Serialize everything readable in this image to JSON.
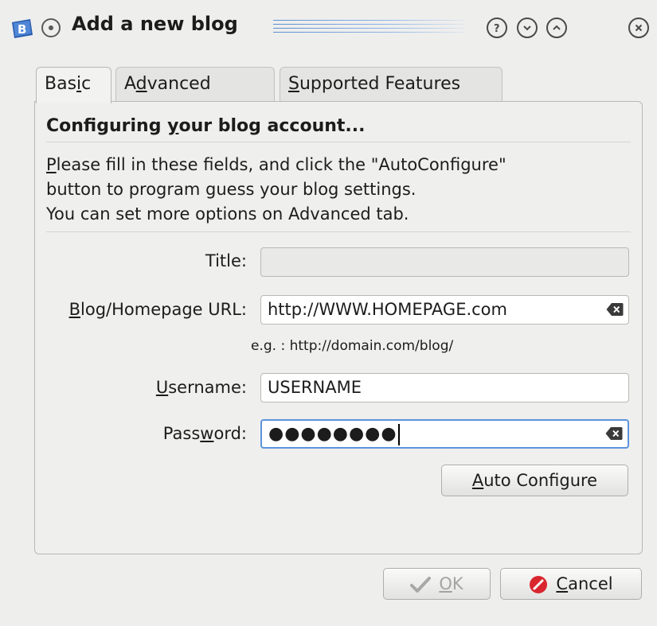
{
  "window": {
    "title": "Add a new blog",
    "app_icon": "blogilo-icon",
    "buttons": [
      "help-icon",
      "minimize-icon",
      "maximize-icon",
      "close-icon"
    ]
  },
  "tabs": [
    {
      "pre": "Bas",
      "accel": "i",
      "post": "c",
      "active": true
    },
    {
      "pre": "A",
      "accel": "d",
      "post": "vanced",
      "active": false
    },
    {
      "pre": "",
      "accel": "S",
      "post": "upported Features",
      "active": false
    }
  ],
  "panel": {
    "heading_pre": "Configuring ",
    "heading_accel": "y",
    "heading_post": "our blog account...",
    "description": {
      "line1_accel": "P",
      "line1_post": "lease fill in these fields, and click the \"AutoConfigure\"",
      "line2": "button to program guess your blog settings.",
      "line3": "You can set more options on Advanced tab."
    }
  },
  "form": {
    "title_label": "Title:",
    "title_value": "",
    "url_label_accel": "B",
    "url_label_post": "log/Homepage URL:",
    "url_value": "http://WWW.HOMEPAGE.com",
    "url_hint": "e.g. : http://domain.com/blog/",
    "username_label_accel": "U",
    "username_label_post": "sername:",
    "username_value": "USERNAME",
    "password_label_pre": "Pass",
    "password_label_accel": "w",
    "password_label_post": "ord:",
    "password_value": "●●●●●●●●",
    "auto_configure_accel": "A",
    "auto_configure_post": "uto Configure"
  },
  "footer": {
    "ok_accel": "O",
    "ok_post": "K",
    "ok_enabled": false,
    "cancel_accel": "C",
    "cancel_post": "ancel"
  },
  "colors": {
    "focus": "#5b93dd",
    "cancel_icon": "#d9262e",
    "app_icon": "#2a5db0"
  }
}
